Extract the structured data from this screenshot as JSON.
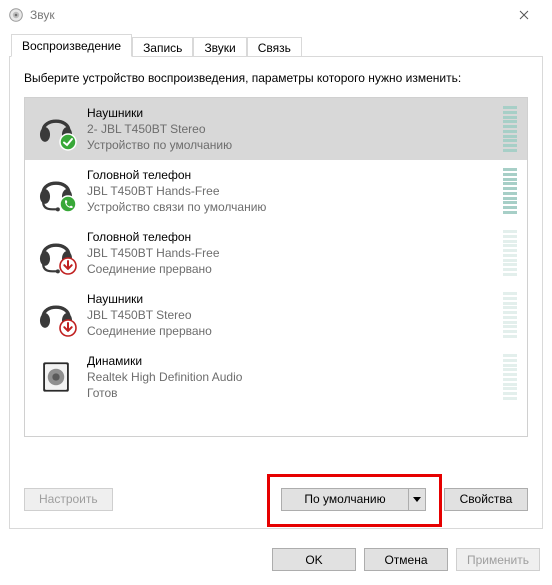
{
  "window": {
    "title": "Звук"
  },
  "tabs": [
    {
      "label": "Воспроизведение",
      "active": true
    },
    {
      "label": "Запись",
      "active": false
    },
    {
      "label": "Звуки",
      "active": false
    },
    {
      "label": "Связь",
      "active": false
    }
  ],
  "instructions": "Выберите устройство воспроизведения, параметры которого нужно изменить:",
  "devices": [
    {
      "name": "Наушники",
      "sub": "2- JBL T450BT Stereo",
      "status": "Устройство по умолчанию",
      "icon": "headphones",
      "badge": "default-check",
      "selected": true,
      "meter": "high"
    },
    {
      "name": "Головной телефон",
      "sub": "JBL T450BT Hands-Free",
      "status": "Устройство связи по умолчанию",
      "icon": "headset",
      "badge": "default-comm",
      "selected": false,
      "meter": "high"
    },
    {
      "name": "Головной телефон",
      "sub": "JBL T450BT Hands-Free",
      "status": "Соединение прервано",
      "icon": "headset",
      "badge": "disconnected",
      "selected": false,
      "meter": "low"
    },
    {
      "name": "Наушники",
      "sub": "JBL T450BT Stereo",
      "status": "Соединение прервано",
      "icon": "headphones",
      "badge": "disconnected",
      "selected": false,
      "meter": "low"
    },
    {
      "name": "Динамики",
      "sub": "Realtek High Definition Audio",
      "status": "Готов",
      "icon": "speakers",
      "badge": "none",
      "selected": false,
      "meter": "low"
    }
  ],
  "buttons": {
    "configure": "Настроить",
    "set_default": "По умолчанию",
    "properties": "Свойства",
    "ok": "OK",
    "cancel": "Отмена",
    "apply": "Применить"
  },
  "highlight": "set_default"
}
